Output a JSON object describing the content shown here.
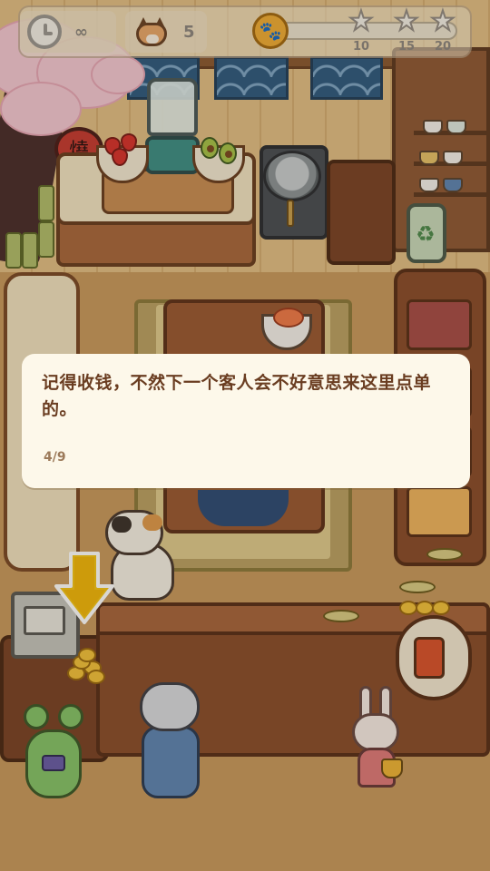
{
  "hud": {
    "timer": {
      "icon": "clock-icon",
      "value": "∞"
    },
    "cats": {
      "icon": "shiba-icon",
      "count": "5"
    },
    "progress": {
      "icon": "paw-coin-icon",
      "fill_fraction": 0,
      "stars": [
        {
          "icon": "star-icon",
          "threshold": "10"
        },
        {
          "icon": "star-icon",
          "threshold": "15"
        },
        {
          "icon": "star-icon",
          "threshold": "20"
        }
      ]
    }
  },
  "scene": {
    "lantern_text": "燒"
  },
  "dialog": {
    "message": "记得收钱，不然下一个客人会不好意思来这里点单的。",
    "progress": "4/9"
  },
  "colors": {
    "arrow": "#f5c518",
    "dialog_text": "#6a3d21",
    "dialog_bg": "#fdf8ea"
  }
}
